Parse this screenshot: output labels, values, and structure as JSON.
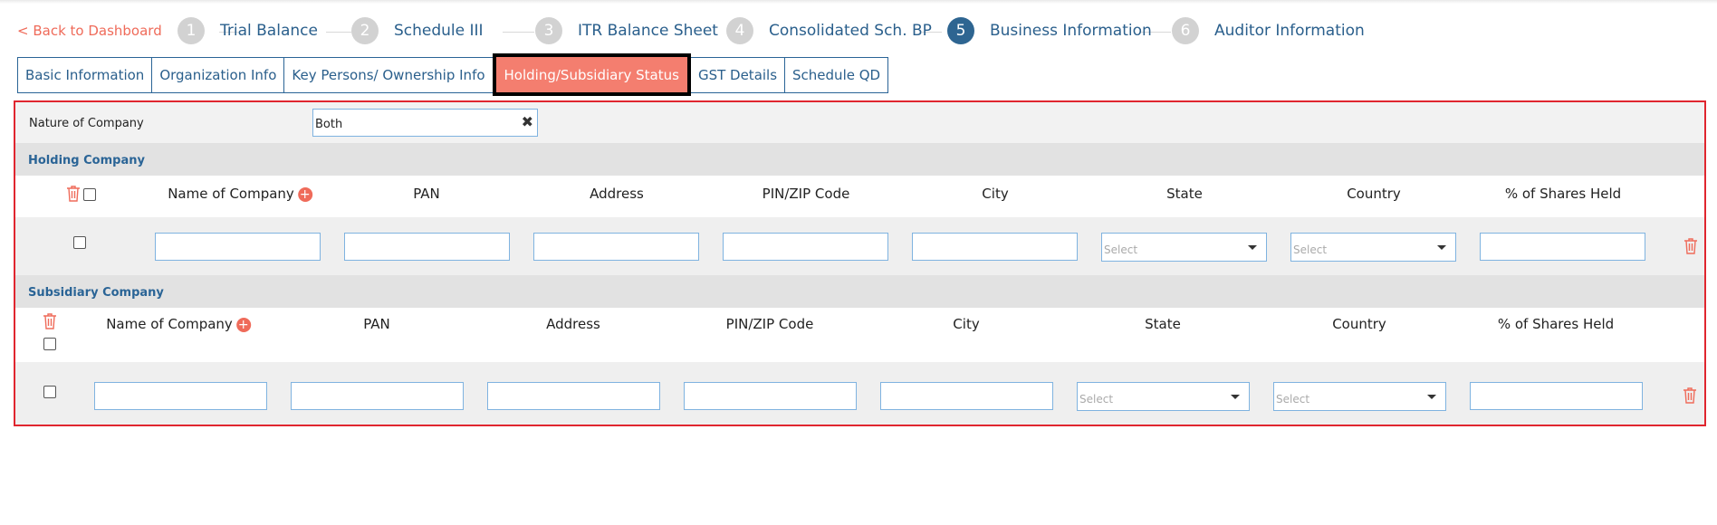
{
  "back_link": "< Back to Dashboard",
  "steps": [
    {
      "num": "1",
      "label": "Trial Balance"
    },
    {
      "num": "2",
      "label": "Schedule III"
    },
    {
      "num": "3",
      "label": "ITR Balance Sheet"
    },
    {
      "num": "4",
      "label": "Consolidated Sch. BP"
    },
    {
      "num": "5",
      "label": "Business Information"
    },
    {
      "num": "6",
      "label": "Auditor Information"
    }
  ],
  "active_step": "5",
  "tabs": [
    {
      "label": "Basic Information"
    },
    {
      "label": "Organization Info"
    },
    {
      "label": "Key Persons/ Ownership Info"
    },
    {
      "label": "Holding/Subsidiary Status"
    },
    {
      "label": "GST Details"
    },
    {
      "label": "Schedule QD"
    }
  ],
  "active_tab": "Holding/Subsidiary Status",
  "nature": {
    "label": "Nature of Company",
    "value": "Both",
    "clear_icon": "✖"
  },
  "holding": {
    "title": "Holding Company",
    "columns": [
      "Name of Company",
      "PAN",
      "Address",
      "PIN/ZIP Code",
      "City",
      "State",
      "Country",
      "% of Shares Held"
    ],
    "state_placeholder": "Select",
    "country_placeholder": "Select"
  },
  "subsidiary": {
    "title": "Subsidiary Company",
    "columns": [
      "Name of Company",
      "PAN",
      "Address",
      "PIN/ZIP Code",
      "City",
      "State",
      "Country",
      "% of Shares Held"
    ],
    "state_placeholder": "Select",
    "country_placeholder": "Select"
  },
  "colors": {
    "accent_red": "#ef6b5a",
    "active_tab_bg": "#f47e6f",
    "primary_blue": "#2a6496",
    "active_step_blue": "#2e6591",
    "error_border": "#e0262f"
  },
  "icons": {
    "add": "plus-circle-icon",
    "delete": "trash-icon",
    "dropdown": "caret-down-icon",
    "clear": "close-icon"
  }
}
